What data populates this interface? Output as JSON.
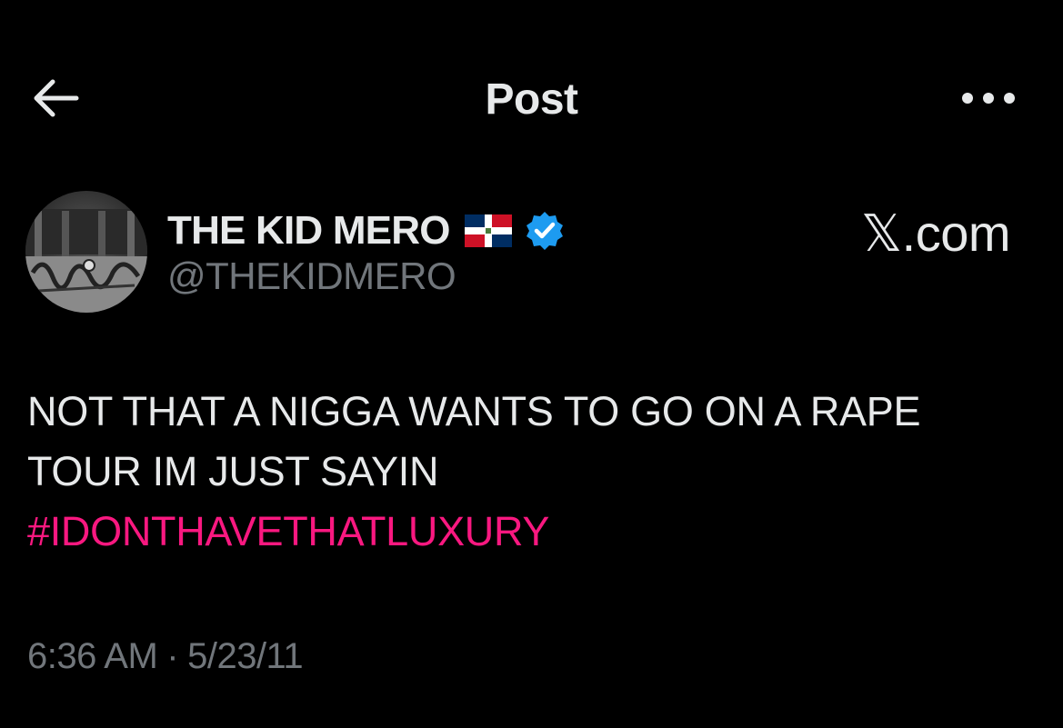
{
  "header": {
    "title": "Post",
    "back_icon": "arrow-left-icon",
    "more_icon": "more-horizontal-icon"
  },
  "author": {
    "display_name": "THE KID MERO",
    "handle": "@THEKIDMERO",
    "flag": "dominican-republic-flag-icon",
    "verified_icon": "verified-badge-icon",
    "verified_color": "#1d9bf0"
  },
  "watermark": {
    "text": "𝕏.com"
  },
  "tweet": {
    "line1": "NOT THAT A NIGGA WANTS TO GO ON A RAPE",
    "line2": "TOUR IM JUST SAYIN",
    "hashtag": "#IDONTHAVETHATLUXURY",
    "hashtag_color": "#f91880"
  },
  "meta": {
    "time": "6:36 AM",
    "separator": "·",
    "date": "5/23/11"
  },
  "colors": {
    "background": "#000000",
    "primary_text": "#e7e9ea",
    "secondary_text": "#71767b"
  }
}
